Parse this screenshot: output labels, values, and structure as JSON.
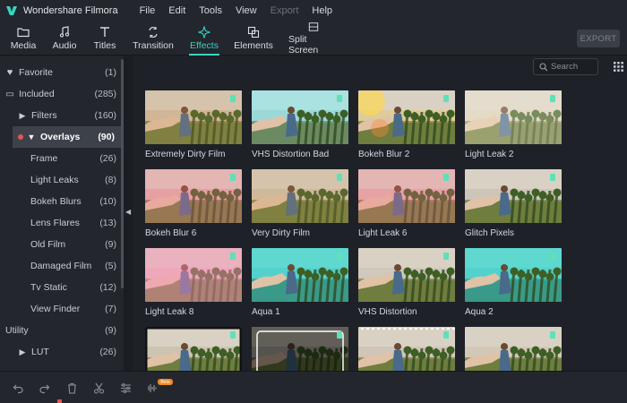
{
  "app": {
    "title": "Wondershare Filmora"
  },
  "menu": [
    {
      "label": "File",
      "disabled": false
    },
    {
      "label": "Edit",
      "disabled": false
    },
    {
      "label": "Tools",
      "disabled": false
    },
    {
      "label": "View",
      "disabled": false
    },
    {
      "label": "Export",
      "disabled": true
    },
    {
      "label": "Help",
      "disabled": false
    }
  ],
  "toolbar": {
    "tabs": [
      {
        "label": "Media",
        "icon": "folder-icon"
      },
      {
        "label": "Audio",
        "icon": "music-note-icon"
      },
      {
        "label": "Titles",
        "icon": "text-icon"
      },
      {
        "label": "Transition",
        "icon": "transition-icon"
      },
      {
        "label": "Effects",
        "icon": "sparkle-icon",
        "active": true
      },
      {
        "label": "Elements",
        "icon": "elements-icon"
      },
      {
        "label": "Split Screen",
        "icon": "split-screen-icon"
      }
    ],
    "export_label": "EXPORT"
  },
  "sidebar": {
    "items": [
      {
        "label": "Favorite",
        "count": "(1)",
        "icon": "heart-icon",
        "level": 0
      },
      {
        "label": "Included",
        "count": "(285)",
        "icon": "folder-icon",
        "level": 0,
        "expanded": true
      },
      {
        "label": "Filters",
        "count": "(160)",
        "icon": "triangle-right-icon",
        "level": 1
      },
      {
        "label": "Overlays",
        "count": "(90)",
        "icon": "triangle-down-icon",
        "level": 1,
        "selected": true
      },
      {
        "label": "Frame",
        "count": "(26)",
        "level": 2
      },
      {
        "label": "Light Leaks",
        "count": "(8)",
        "level": 2
      },
      {
        "label": "Bokeh Blurs",
        "count": "(10)",
        "level": 2
      },
      {
        "label": "Lens Flares",
        "count": "(13)",
        "level": 2
      },
      {
        "label": "Old Film",
        "count": "(9)",
        "level": 2
      },
      {
        "label": "Damaged Film",
        "count": "(5)",
        "level": 2
      },
      {
        "label": "Tv Static",
        "count": "(12)",
        "level": 2
      },
      {
        "label": "View Finder",
        "count": "(7)",
        "level": 2
      },
      {
        "label": "Utility",
        "count": "(9)",
        "level": 0
      },
      {
        "label": "LUT",
        "count": "(26)",
        "icon": "triangle-right-icon",
        "level": 1
      }
    ]
  },
  "search": {
    "placeholder": "Search"
  },
  "effects": [
    {
      "label": "Extremely Dirty Film",
      "tint": "#caa07a",
      "style": "warm"
    },
    {
      "label": "VHS Distortion Bad",
      "tint": "#7ec8c8",
      "style": "vhs"
    },
    {
      "label": "Bokeh Blur 2",
      "tint": "#e8c24a",
      "style": "bokeh"
    },
    {
      "label": "Light Leak 2",
      "tint": "#d9c8a8",
      "style": "bright"
    },
    {
      "label": "Bokeh Blur 6",
      "tint": "#e87a8a",
      "style": "pink"
    },
    {
      "label": "Very Dirty Film",
      "tint": "#c8b08a",
      "style": "warm"
    },
    {
      "label": "Light Leak 6",
      "tint": "#e88a8a",
      "style": "pink"
    },
    {
      "label": "Glitch Pixels",
      "tint": "#b8b0a8",
      "style": "plain"
    },
    {
      "label": "Light Leak 8",
      "tint": "#f4a0b8",
      "style": "magenta"
    },
    {
      "label": "Aqua 1",
      "tint": "#40c8c8",
      "style": "aqua"
    },
    {
      "label": "VHS Distortion",
      "tint": "#c0b8b0",
      "style": "plain"
    },
    {
      "label": "Aqua 2",
      "tint": "#40c8c8",
      "style": "aqua"
    },
    {
      "label": "",
      "tint": "#b8a890",
      "style": "frame"
    },
    {
      "label": "",
      "tint": "#8a8a8a",
      "style": "viewfinder"
    },
    {
      "label": "",
      "tint": "#c0b0a0",
      "style": "film"
    },
    {
      "label": "",
      "tint": "#c8b8a0",
      "style": "plain"
    }
  ]
}
